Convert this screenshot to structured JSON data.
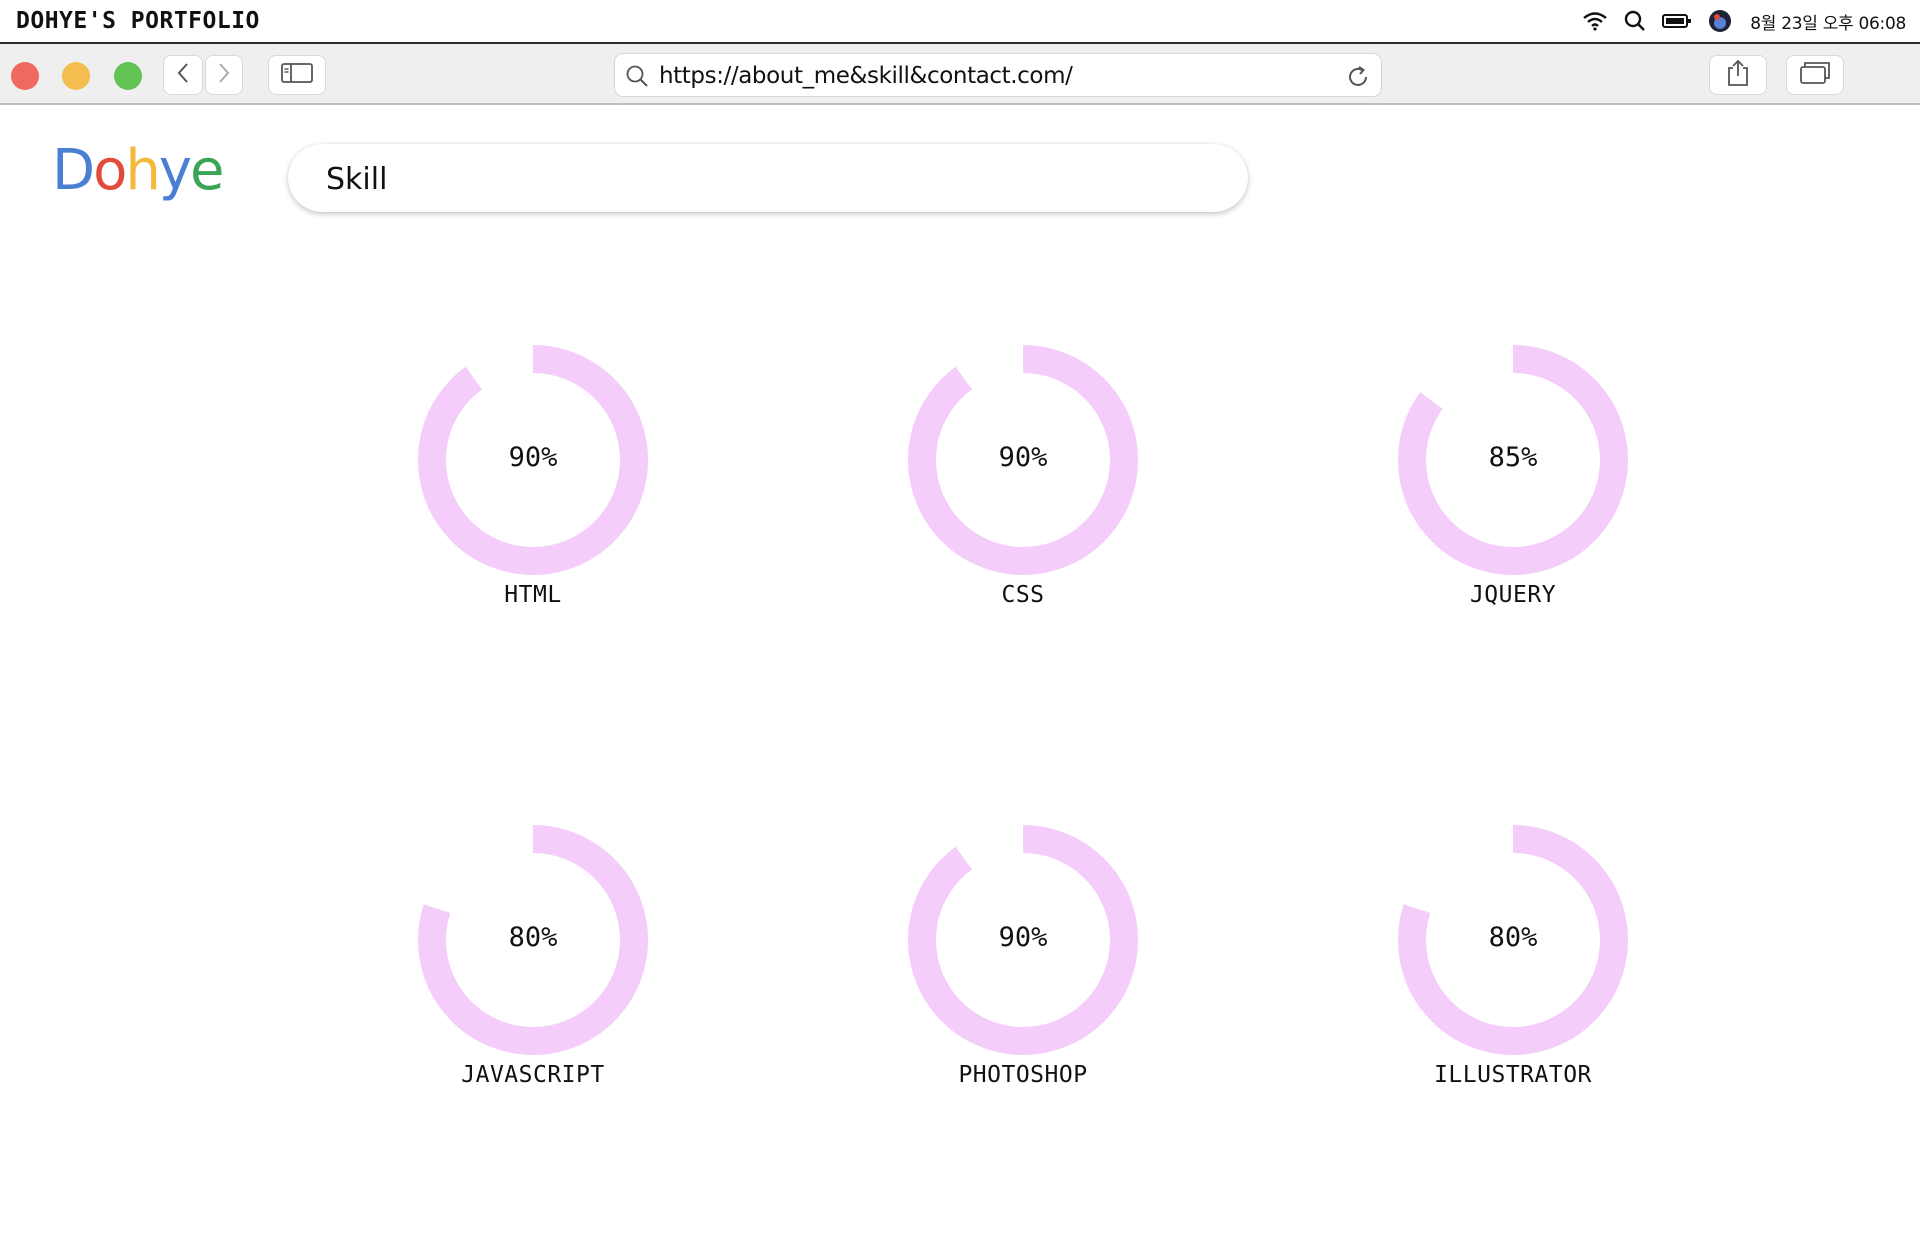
{
  "menubar": {
    "app_title": "DOHYE'S PORTFOLIO",
    "clock": "8월 23일 오후 06:08",
    "icons": [
      "wifi-icon",
      "spotlight-search-icon",
      "battery-icon",
      "user-avatar-icon"
    ]
  },
  "browser": {
    "url": "https://about_me&skill&contact.com/",
    "icons": [
      "back-arrow-icon",
      "forward-arrow-icon",
      "sidebar-icon",
      "search-icon",
      "reload-icon",
      "share-icon",
      "tabs-icon"
    ]
  },
  "page": {
    "logo": [
      "D",
      "o",
      "h",
      "y",
      "e"
    ],
    "logo_colors": [
      "#4a7fd4",
      "#e04b3a",
      "#f3b93a",
      "#4a7fd4",
      "#3aa655"
    ],
    "search_value": "Skill",
    "ring_color": "#f5cdfb",
    "skills": [
      {
        "name": "HTML",
        "percent": 90,
        "label": "90%"
      },
      {
        "name": "CSS",
        "percent": 90,
        "label": "90%"
      },
      {
        "name": "JQUERY",
        "percent": 85,
        "label": "85%"
      },
      {
        "name": "JAVASCRIPT",
        "percent": 80,
        "label": "80%"
      },
      {
        "name": "PHOTOSHOP",
        "percent": 90,
        "label": "90%"
      },
      {
        "name": "ILLUSTRATOR",
        "percent": 80,
        "label": "80%"
      }
    ]
  }
}
